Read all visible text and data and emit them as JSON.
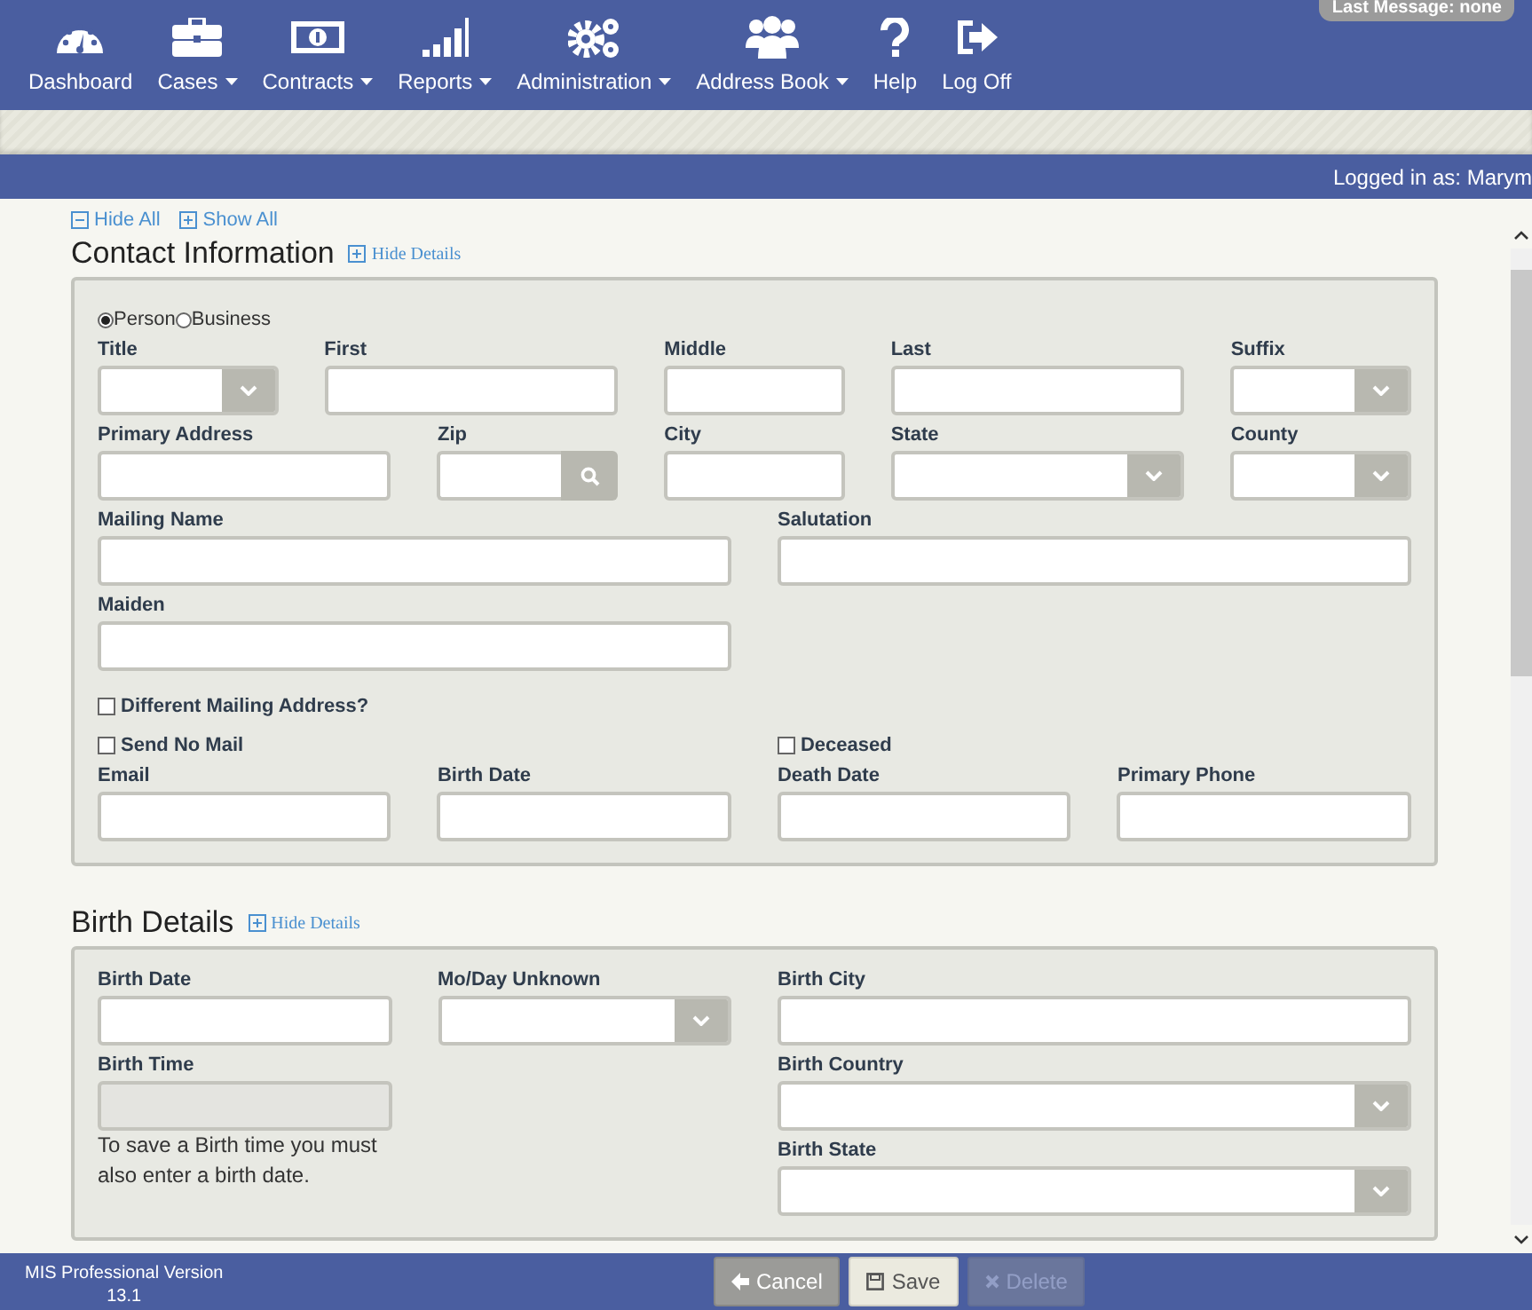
{
  "top_badge": "Last Message: none",
  "nav": [
    {
      "label": "Dashboard",
      "dropdown": false
    },
    {
      "label": "Cases",
      "dropdown": true
    },
    {
      "label": "Contracts",
      "dropdown": true
    },
    {
      "label": "Reports",
      "dropdown": true
    },
    {
      "label": "Administration",
      "dropdown": true
    },
    {
      "label": "Address Book",
      "dropdown": true
    },
    {
      "label": "Help",
      "dropdown": false
    },
    {
      "label": "Log Off",
      "dropdown": false
    }
  ],
  "user_bar": "Logged in as: Marym",
  "toggles": [
    {
      "label": "Hide All",
      "kind": "collapse"
    },
    {
      "label": "Show All",
      "kind": "expand"
    }
  ],
  "sections": [
    {
      "title": "Contact Information",
      "toggle": "Hide Details",
      "radios": [
        {
          "label": "Person",
          "selected": true
        },
        {
          "label": "Business",
          "selected": false
        }
      ],
      "fields": [
        {
          "kind": "select",
          "label": "Title"
        },
        {
          "kind": "text",
          "label": "First",
          "disabled": false
        },
        {
          "kind": "text",
          "label": "Middle",
          "disabled": false
        },
        {
          "kind": "text",
          "label": "Last",
          "disabled": false
        },
        {
          "kind": "select",
          "label": "Suffix"
        },
        {
          "kind": "text",
          "label": "Primary Address",
          "disabled": false
        },
        {
          "kind": "search",
          "label": "Zip",
          "disabled": false
        },
        {
          "kind": "text",
          "label": "City",
          "disabled": false
        },
        {
          "kind": "select",
          "label": "State"
        },
        {
          "kind": "select",
          "label": "County"
        },
        {
          "kind": "text",
          "label": "Mailing Name",
          "disabled": false
        },
        {
          "kind": "text",
          "label": "Salutation",
          "disabled": false
        },
        {
          "kind": "text",
          "label": "Maiden",
          "disabled": false
        },
        {
          "kind": "checkbox",
          "label": "Different Mailing Address?",
          "checked": false
        },
        {
          "kind": "checkbox",
          "label": "Send No Mail",
          "checked": false
        },
        {
          "kind": "checkbox",
          "label": "Deceased",
          "checked": false
        },
        {
          "kind": "text",
          "label": "Email",
          "disabled": false
        },
        {
          "kind": "text",
          "label": "Birth Date",
          "disabled": false
        },
        {
          "kind": "text",
          "label": "Death Date",
          "disabled": false
        },
        {
          "kind": "text",
          "label": "Primary Phone",
          "disabled": false
        }
      ]
    },
    {
      "title": "Birth Details",
      "toggle": "Hide Details",
      "fields": [
        {
          "kind": "text",
          "label": "Birth Date",
          "disabled": false
        },
        {
          "kind": "select",
          "label": "Mo/Day Unknown"
        },
        {
          "kind": "text",
          "label": "Birth City",
          "disabled": false
        },
        {
          "kind": "text",
          "label": "Birth Time",
          "disabled": true
        },
        {
          "kind": "select",
          "label": "Birth Country"
        },
        {
          "kind": "note",
          "text": "To save a Birth time you must also enter a birth date."
        },
        {
          "kind": "select",
          "label": "Birth State"
        }
      ]
    }
  ],
  "footer": {
    "product": "MIS Professional Version",
    "version": "13.1",
    "buttons": [
      {
        "label": "Cancel",
        "kind": "cancel",
        "disabled": false
      },
      {
        "label": "Save",
        "kind": "save",
        "disabled": false
      },
      {
        "label": "Delete",
        "kind": "delete",
        "disabled": true
      }
    ]
  }
}
